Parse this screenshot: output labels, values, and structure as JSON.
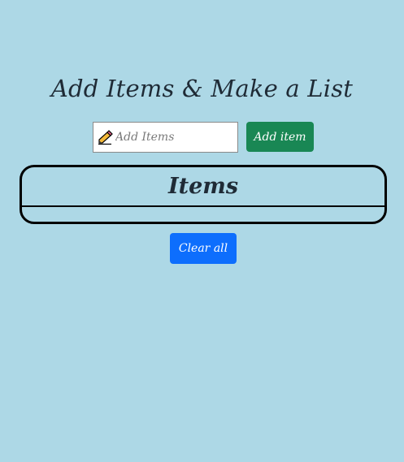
{
  "header": {
    "title": "Add Items & Make a List"
  },
  "form": {
    "input_value": "",
    "input_placeholder": "Add Items",
    "add_button_label": "Add item",
    "input_icon": "pencil-icon"
  },
  "list": {
    "heading": "Items",
    "items": []
  },
  "actions": {
    "clear_button_label": "Clear all"
  },
  "colors": {
    "background": "#add8e6",
    "add_button": "#198754",
    "clear_button": "#0d6efd",
    "text": "#1f2b36"
  }
}
